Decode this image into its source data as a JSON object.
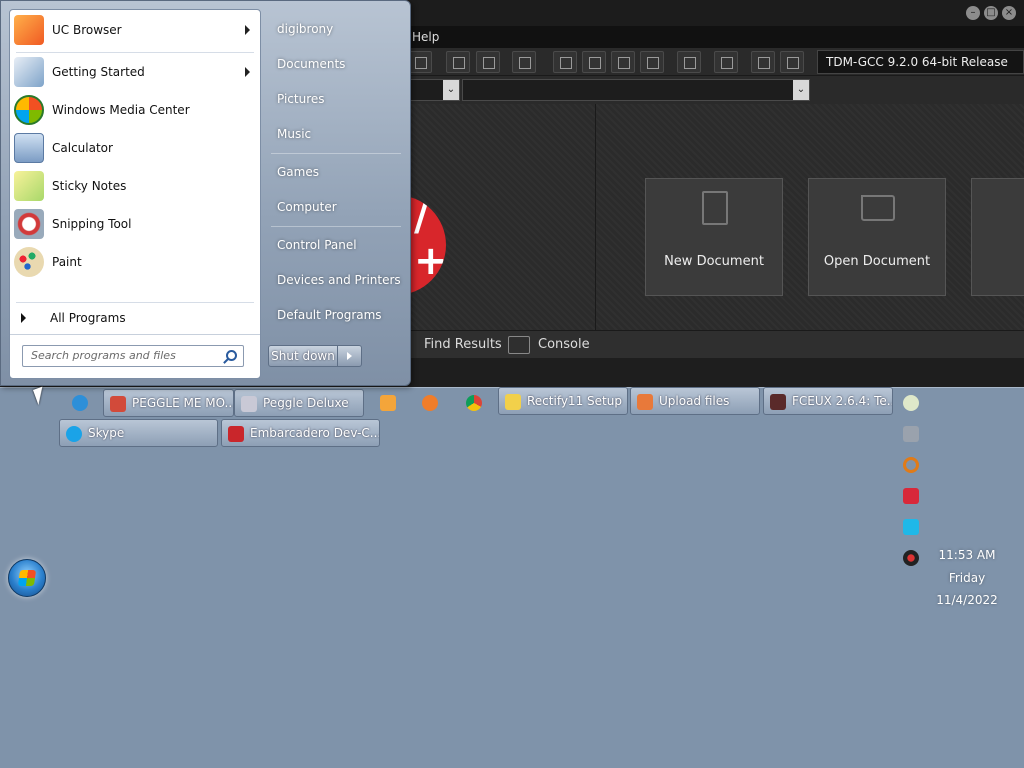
{
  "app": {
    "menu_help": "Help",
    "compiler": "TDM-GCC 9.2.0 64-bit Release",
    "tiles": [
      {
        "label": "New Document",
        "icon": "document-icon"
      },
      {
        "label": "Open Document",
        "icon": "folder-icon"
      }
    ],
    "bottom_tabs": [
      {
        "label": "Find Results",
        "icon": "find-icon"
      },
      {
        "label": "Console",
        "icon": "console-icon"
      }
    ]
  },
  "start_menu": {
    "programs": [
      {
        "label": "UC Browser",
        "icon": "uc-browser-icon",
        "submenu": true
      },
      {
        "label": "Getting Started",
        "icon": "getting-started-icon",
        "submenu": true
      },
      {
        "label": "Windows Media Center",
        "icon": "media-center-icon",
        "submenu": false
      },
      {
        "label": "Calculator",
        "icon": "calculator-icon",
        "submenu": false
      },
      {
        "label": "Sticky Notes",
        "icon": "sticky-notes-icon",
        "submenu": false
      },
      {
        "label": "Snipping Tool",
        "icon": "snipping-tool-icon",
        "submenu": false
      },
      {
        "label": "Paint",
        "icon": "paint-icon",
        "submenu": false
      }
    ],
    "all_programs": "All Programs",
    "search_placeholder": "Search programs and files",
    "places": [
      "digibrony",
      "Documents",
      "Pictures",
      "Music",
      "Games",
      "Computer",
      "Control Panel",
      "Devices and Printers",
      "Default Programs"
    ],
    "shutdown": "Shut down"
  },
  "taskbar": {
    "buttons": [
      {
        "label": "PEGGLE ME MO...",
        "icon": "peggle-icon"
      },
      {
        "label": "Peggle Deluxe",
        "icon": "peggle-deluxe-icon"
      },
      {
        "label": "Rectify11 Setup",
        "icon": "rectify11-icon"
      },
      {
        "label": "Upload files",
        "icon": "upload-icon"
      },
      {
        "label": "FCEUX 2.6.4: Te...",
        "icon": "fceux-icon"
      },
      {
        "label": "Skype",
        "icon": "skype-icon"
      },
      {
        "label": "Embarcadero Dev-C...",
        "icon": "devcpp-icon"
      }
    ],
    "pinned": [
      "internet-explorer-icon",
      "media-player-icon",
      "uc-browser-icon",
      "chrome-icon"
    ],
    "tray": [
      "network-icon",
      "settings-icon",
      "search-icon",
      "flag-icon",
      "monitor-icon",
      "speaker-icon"
    ],
    "clock": {
      "time": "11:53 AM",
      "day": "Friday",
      "date": "11/4/2022"
    }
  }
}
